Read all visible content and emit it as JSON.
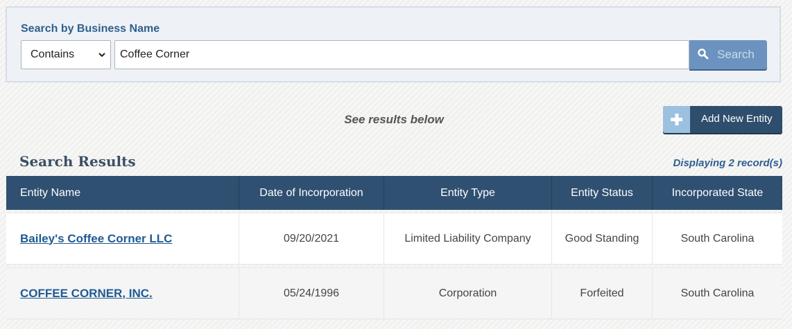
{
  "search": {
    "label": "Search by Business Name",
    "mode": "Contains",
    "query": "Coffee Corner",
    "button_label": "Search"
  },
  "results_hint": "See results below",
  "add_entity_label": "Add New Entity",
  "results": {
    "title": "Search Results",
    "record_count": "Displaying 2 record(s)",
    "columns": [
      "Entity Name",
      "Date of Incorporation",
      "Entity Type",
      "Entity Status",
      "Incorporated State"
    ],
    "rows": [
      {
        "name": "Bailey's Coffee Corner LLC",
        "date": "09/20/2021",
        "type": "Limited Liability Company",
        "status": "Good Standing",
        "state": "South Carolina"
      },
      {
        "name": "COFFEE CORNER, INC.",
        "date": "05/24/1996",
        "type": "Corporation",
        "status": "Forfeited",
        "state": "South Carolina"
      }
    ]
  },
  "colors": {
    "header": "#2f5071",
    "accent": "#2f5f8e",
    "search_button": "#6c93bf",
    "add_button": "#2f4e6d"
  },
  "icons": {
    "search_button": "magnifier-icon",
    "add_button": "plus-icon",
    "select": "chevron-down-icon"
  }
}
